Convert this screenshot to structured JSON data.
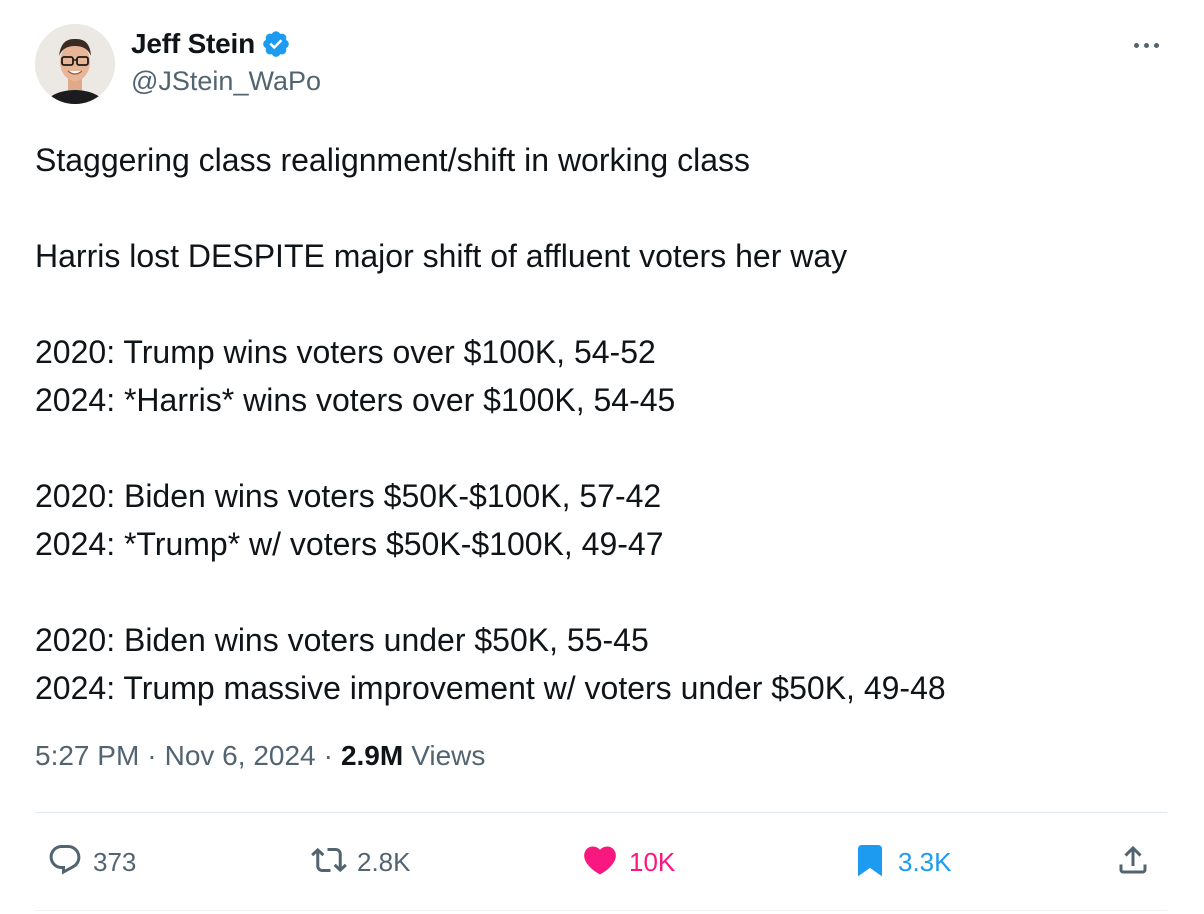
{
  "author": {
    "name": "Jeff Stein",
    "handle": "@JStein_WaPo",
    "verified": true,
    "verified_color": "#1d9bf0"
  },
  "tweet": {
    "lines": [
      "Staggering class realignment/shift in working class",
      "",
      "Harris lost DESPITE major shift of affluent voters her way",
      "",
      "2020: Trump wins voters over $100K, 54-52",
      "2024: *Harris* wins voters over $100K, 54-45",
      "",
      "2020: Biden wins voters $50K-$100K, 57-42",
      "2024: *Trump* w/ voters $50K-$100K, 49-47",
      "",
      "2020: Biden wins voters under $50K, 55-45",
      "2024: Trump massive improvement w/ voters under $50K, 49-48"
    ],
    "time": "5:27 PM",
    "date": "Nov 6, 2024",
    "views_count": "2.9M",
    "views_label": "Views"
  },
  "actions": {
    "reply": {
      "icon": "reply-icon",
      "count": "373"
    },
    "repost": {
      "icon": "repost-icon",
      "count": "2.8K"
    },
    "like": {
      "icon": "heart-icon",
      "count": "10K",
      "color": "#f91880"
    },
    "bookmark": {
      "icon": "bookmark-icon",
      "count": "3.3K",
      "color": "#1d9bf0"
    },
    "share": {
      "icon": "share-icon"
    }
  }
}
